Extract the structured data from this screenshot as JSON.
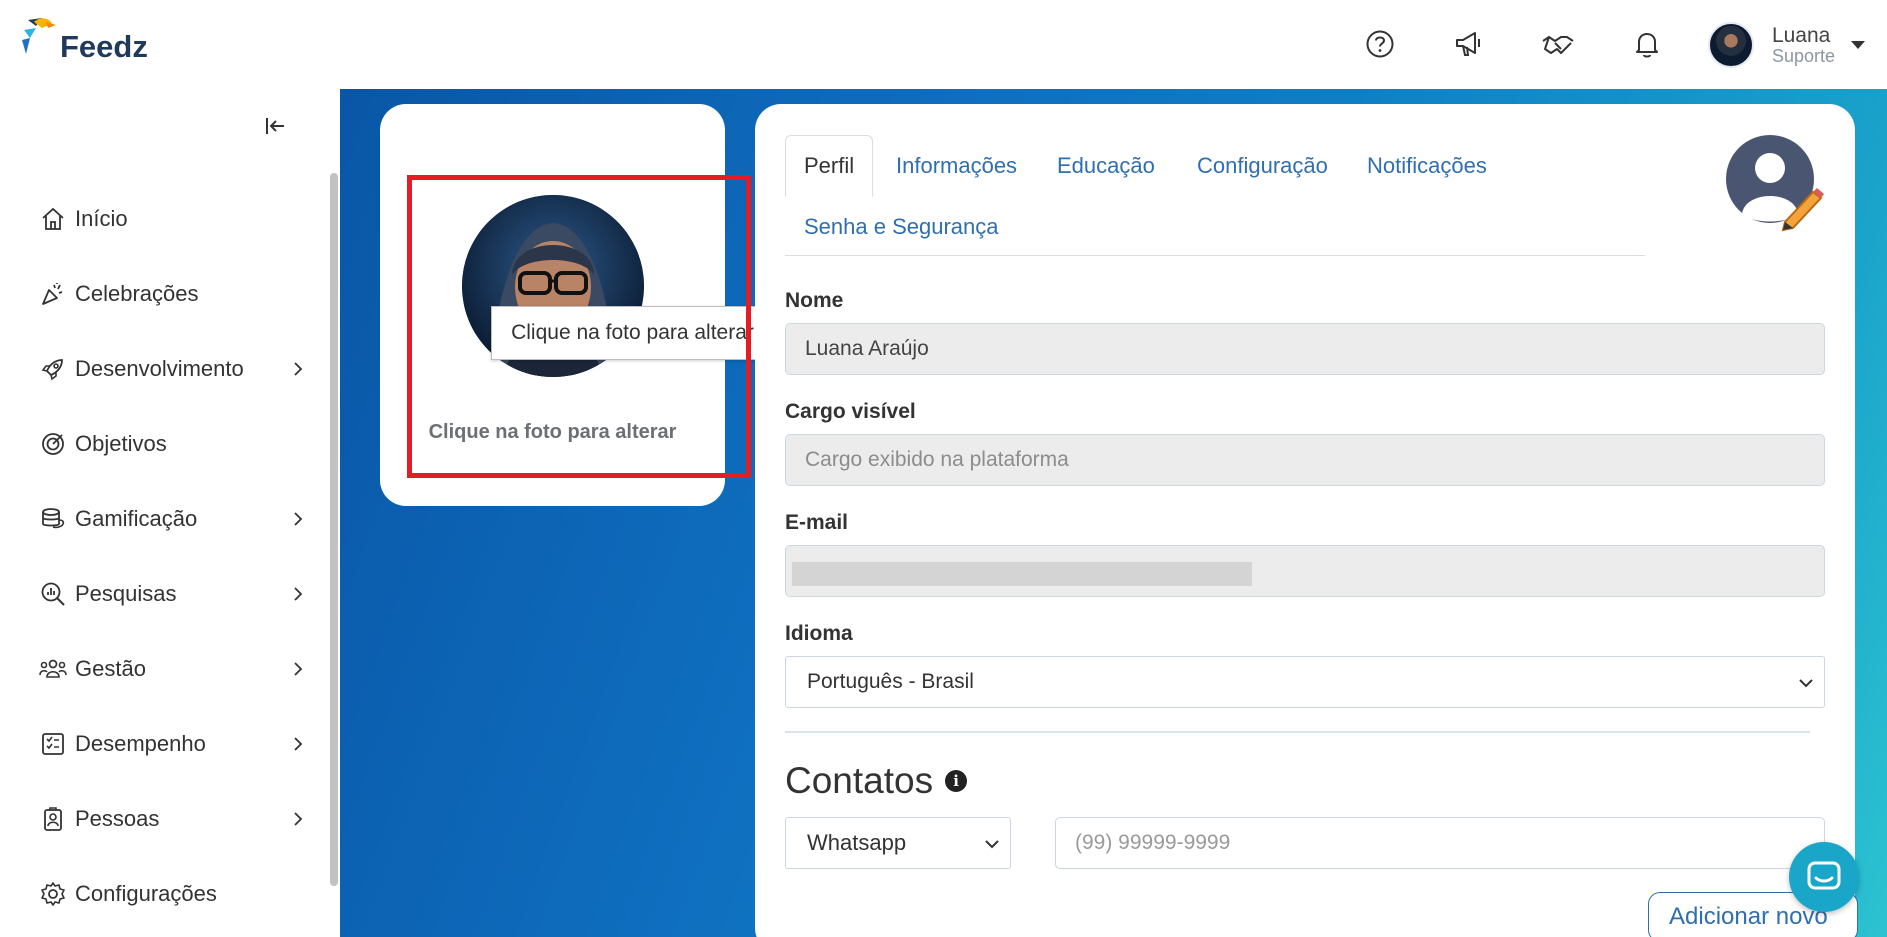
{
  "app": {
    "logo_text": "Feedz"
  },
  "header": {
    "icons": [
      "help-icon",
      "megaphone-icon",
      "handshake-icon",
      "bell-icon"
    ],
    "user": {
      "name": "Luana",
      "role": "Suporte"
    }
  },
  "sidebar": {
    "items": [
      {
        "label": "Início",
        "icon": "home-icon",
        "has_submenu": false
      },
      {
        "label": "Celebrações",
        "icon": "party-icon",
        "has_submenu": false
      },
      {
        "label": "Desenvolvimento",
        "icon": "rocket-icon",
        "has_submenu": true
      },
      {
        "label": "Objetivos",
        "icon": "target-icon",
        "has_submenu": false
      },
      {
        "label": "Gamificação",
        "icon": "coins-icon",
        "has_submenu": true
      },
      {
        "label": "Pesquisas",
        "icon": "survey-icon",
        "has_submenu": true
      },
      {
        "label": "Gestão",
        "icon": "people-icon",
        "has_submenu": true
      },
      {
        "label": "Desempenho",
        "icon": "checklist-icon",
        "has_submenu": true
      },
      {
        "label": "Pessoas",
        "icon": "badge-icon",
        "has_submenu": true
      },
      {
        "label": "Configurações",
        "icon": "gear-icon",
        "has_submenu": false
      }
    ]
  },
  "photo_card": {
    "caption": "Clique na foto para alterar",
    "tooltip": "Clique na foto para alterar"
  },
  "profile": {
    "tabs": [
      {
        "label": "Perfil",
        "active": true
      },
      {
        "label": "Informações",
        "active": false
      },
      {
        "label": "Educação",
        "active": false
      },
      {
        "label": "Configuração",
        "active": false
      },
      {
        "label": "Notificações",
        "active": false
      },
      {
        "label": "Senha e Segurança",
        "active": false
      }
    ],
    "fields": {
      "name": {
        "label": "Nome",
        "value": "Luana Araújo"
      },
      "job": {
        "label": "Cargo visível",
        "placeholder": "Cargo exibido na plataforma"
      },
      "email": {
        "label": "E-mail",
        "value": ""
      },
      "language": {
        "label": "Idioma",
        "value": "Português - Brasil"
      }
    },
    "contacts": {
      "title": "Contatos",
      "type": "Whatsapp",
      "phone_placeholder": "(99) 99999-9999",
      "add_label": "Adicionar novo"
    }
  },
  "colors": {
    "accent": "#2f6fb0",
    "highlight": "#e41c24",
    "chat": "#1aa6c9"
  }
}
